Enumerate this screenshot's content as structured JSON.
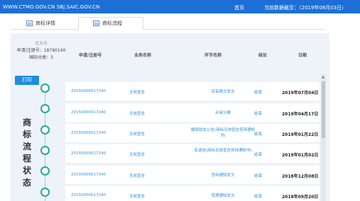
{
  "topbar": {
    "site": "WWW.CTMO.GOV.CN  SBJ.SAIC.GOV.CN",
    "home": "首页",
    "deadline": "当前数据截至：（2019年08月03日）"
  },
  "tabs": [
    {
      "label": "商标详情",
      "active": false
    },
    {
      "label": "商标流程",
      "active": true
    }
  ],
  "trademark": {
    "name": "太太乐",
    "reg_no": "申请/注册号：18790140",
    "class": "国际分类：3"
  },
  "table": {
    "headers": [
      "申请/注册号",
      "业务名称",
      "环节名称",
      "结论",
      "日期"
    ],
    "rows": [
      {
        "reg_no": "2015000001724​0",
        "business": "无效宣告",
        "step": "实审裁文发文",
        "result": "结束",
        "date": "2019年07月04日"
      },
      {
        "reg_no": "20150000017240",
        "business": "无效宣告",
        "step": "评审分案",
        "result": "结束",
        "date": "2019年04月17日"
      },
      {
        "reg_no": "20150000017240",
        "business": "无效宣告",
        "step": "撤销状态公告(商标无效宣告答辩通知书)",
        "result": "结束",
        "date": "2019年01月22日"
      },
      {
        "reg_no": "20150000017240",
        "business": "无效宣告",
        "step": "有退信(商标无效宣告答辩通知书)",
        "result": "结束",
        "date": "2019年01月02日"
      },
      {
        "reg_no": "20150000017240",
        "business": "无效宣告",
        "step": "答辩通知发文",
        "result": "结束",
        "date": "2018年12月08日"
      },
      {
        "reg_no": "20150000017240",
        "business": "无效宣告",
        "step": "受理通知发文",
        "result": "结束",
        "date": "2018年09月20日"
      }
    ]
  },
  "print_label": "打印",
  "vertical_title": "商标流程状态",
  "colors": {
    "topbar": "#1d6fd6",
    "accent": "#1d8de0",
    "timeline": "#23a99c",
    "link": "#2f8fd8"
  }
}
